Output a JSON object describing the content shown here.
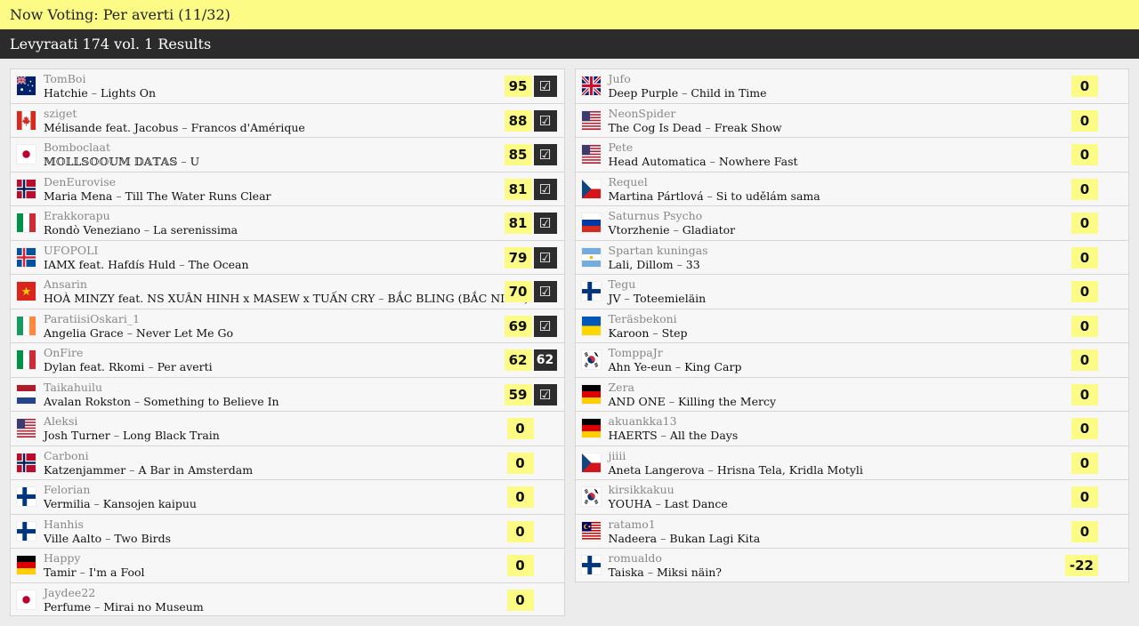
{
  "header": {
    "now_voting": "Now Voting: Per averti (11/32)"
  },
  "subheader": {
    "title": "Levyraati 174 vol. 1 Results"
  },
  "left": [
    {
      "user": "TomBoi",
      "artist": "Hatchie",
      "title": "Lights On",
      "score": "95",
      "flag": "australia",
      "mark": "check"
    },
    {
      "user": "sziget",
      "artist": "Mélisande feat. Jacobus",
      "title": "Francos d'Amérique",
      "score": "88",
      "flag": "canada",
      "mark": "check"
    },
    {
      "user": "Bomboclaat",
      "artist": "𝕄𝕆𝕃𝕃𝕊𝕆𝕆𝕌𝕄 𝔻𝔸𝕋𝔸𝕊",
      "title": "U",
      "score": "85",
      "flag": "japan",
      "mark": "check"
    },
    {
      "user": "DenEurovise",
      "artist": "Maria Mena",
      "title": "Till The Water Runs Clear",
      "score": "81",
      "flag": "norway",
      "mark": "check"
    },
    {
      "user": "Erakkorapu",
      "artist": "Rondò Veneziano",
      "title": "La serenissima",
      "score": "81",
      "flag": "italy",
      "mark": "check"
    },
    {
      "user": "UFOPOLI",
      "artist": "IAMX feat. Hafdís Huld",
      "title": "The Ocean",
      "score": "79",
      "flag": "iceland",
      "mark": "check"
    },
    {
      "user": "Ansarin",
      "artist": "HOÀ MINZY feat. NS XUÂN HINH x MASEW x TUẤN CRY",
      "title": "BẮC BLING (BẮC NINH)",
      "score": "70",
      "flag": "vietnam",
      "mark": "check"
    },
    {
      "user": "ParatiisiOskari_1",
      "artist": "Angelia Grace",
      "title": "Never Let Me Go",
      "score": "69",
      "flag": "ireland",
      "mark": "check"
    },
    {
      "user": "OnFire",
      "artist": "Dylan feat. Rkomi",
      "title": "Per averti",
      "score": "62",
      "flag": "italy",
      "mark": "62"
    },
    {
      "user": "Taikahuilu",
      "artist": "Avalan Rokston",
      "title": "Something to Believe In",
      "score": "59",
      "flag": "netherlands",
      "mark": "check"
    },
    {
      "user": "Aleksi",
      "artist": "Josh Turner",
      "title": "Long Black Train",
      "score": "0",
      "flag": "usa",
      "mark": ""
    },
    {
      "user": "Carboni",
      "artist": "Katzenjammer",
      "title": "A Bar in Amsterdam",
      "score": "0",
      "flag": "norway",
      "mark": ""
    },
    {
      "user": "Felorian",
      "artist": "Vermilia",
      "title": "Kansojen kaipuu",
      "score": "0",
      "flag": "finland",
      "mark": ""
    },
    {
      "user": "Hanhis",
      "artist": "Ville Aalto",
      "title": "Two Birds",
      "score": "0",
      "flag": "finland",
      "mark": ""
    },
    {
      "user": "Happy",
      "artist": "Tamir",
      "title": "I'm a Fool",
      "score": "0",
      "flag": "germany",
      "mark": ""
    },
    {
      "user": "Jaydee22",
      "artist": "Perfume",
      "title": "Mirai no Museum",
      "score": "0",
      "flag": "japan",
      "mark": ""
    }
  ],
  "right": [
    {
      "user": "Jufo",
      "artist": "Deep Purple",
      "title": "Child in Time",
      "score": "0",
      "flag": "uk"
    },
    {
      "user": "NeonSpider",
      "artist": "The Cog Is Dead",
      "title": "Freak Show",
      "score": "0",
      "flag": "usa"
    },
    {
      "user": "Pete",
      "artist": "Head Automatica",
      "title": "Nowhere Fast",
      "score": "0",
      "flag": "usa"
    },
    {
      "user": "Requel",
      "artist": "Martina Pártlová",
      "title": "Si to udělám sama",
      "score": "0",
      "flag": "czech"
    },
    {
      "user": "Saturnus Psycho",
      "artist": "Vtorzhenie",
      "title": "Gladiator",
      "score": "0",
      "flag": "russia"
    },
    {
      "user": "Spartan kuningas",
      "artist": "Lali, Dillom",
      "title": "33",
      "score": "0",
      "flag": "argentina"
    },
    {
      "user": "Tegu",
      "artist": "JV",
      "title": "Toteemieläin",
      "score": "0",
      "flag": "finland"
    },
    {
      "user": "Teräsbekoni",
      "artist": "Karoon",
      "title": "Step",
      "score": "0",
      "flag": "ukraine"
    },
    {
      "user": "TomppaJr",
      "artist": "Ahn Ye-eun",
      "title": "King Carp",
      "score": "0",
      "flag": "korea"
    },
    {
      "user": "Zera",
      "artist": "AND ONE",
      "title": "Killing the Mercy",
      "score": "0",
      "flag": "germany"
    },
    {
      "user": "akuankka13",
      "artist": "HAERTS",
      "title": "All the Days",
      "score": "0",
      "flag": "germany"
    },
    {
      "user": "jiiii",
      "artist": "Aneta Langerova",
      "title": "Hrisna Tela, Kridla Motyli",
      "score": "0",
      "flag": "czech"
    },
    {
      "user": "kirsikkakuu",
      "artist": "YOUHA",
      "title": "Last Dance",
      "score": "0",
      "flag": "korea"
    },
    {
      "user": "ratamo1",
      "artist": "Nadeera",
      "title": "Bukan Lagi Kita",
      "score": "0",
      "flag": "malaysia"
    },
    {
      "user": "romualdo",
      "artist": "Taiska",
      "title": "Miksi näin?",
      "score": "-22",
      "flag": "finland"
    }
  ],
  "separator": " – ",
  "check_glyph": "☑"
}
